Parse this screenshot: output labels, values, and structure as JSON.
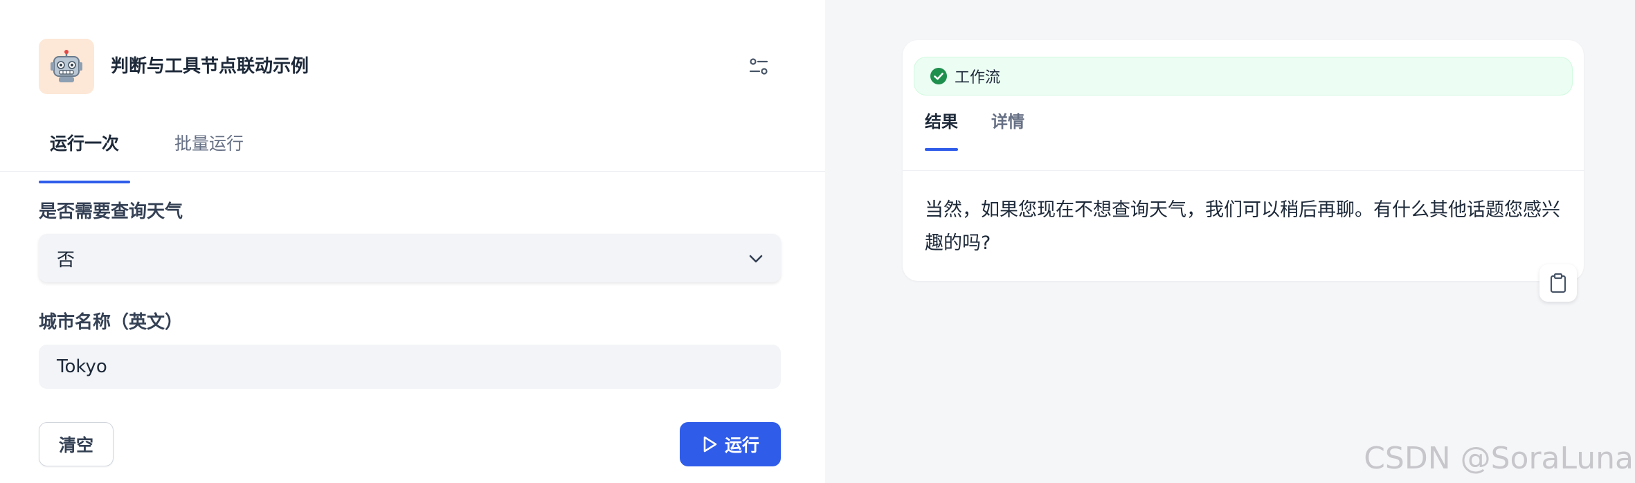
{
  "app": {
    "title": "判断与工具节点联动示例",
    "icon": "robot-icon",
    "icon_bg": "#fde7d6"
  },
  "run_panel": {
    "tabs": [
      {
        "label": "运行一次",
        "active": true
      },
      {
        "label": "批量运行",
        "active": false
      }
    ],
    "fields": {
      "need_weather": {
        "label": "是否需要查询天气",
        "selected": "否"
      },
      "city": {
        "label": "城市名称（英文）",
        "value": "Tokyo"
      }
    },
    "clear_label": "清空",
    "run_label": "运行"
  },
  "result_panel": {
    "status_label": "工作流",
    "status_color": "#12b76a",
    "tabs": [
      {
        "label": "结果",
        "active": true
      },
      {
        "label": "详情",
        "active": false
      }
    ],
    "output_text": "当然，如果您现在不想查询天气，我们可以稍后再聊。有什么其他话题您感兴趣的吗?"
  },
  "watermark": "CSDN @SoraLuna",
  "colors": {
    "accent": "#2f5ce9",
    "success_bg": "#ecfdf3",
    "right_bg": "#f5f6f8"
  }
}
